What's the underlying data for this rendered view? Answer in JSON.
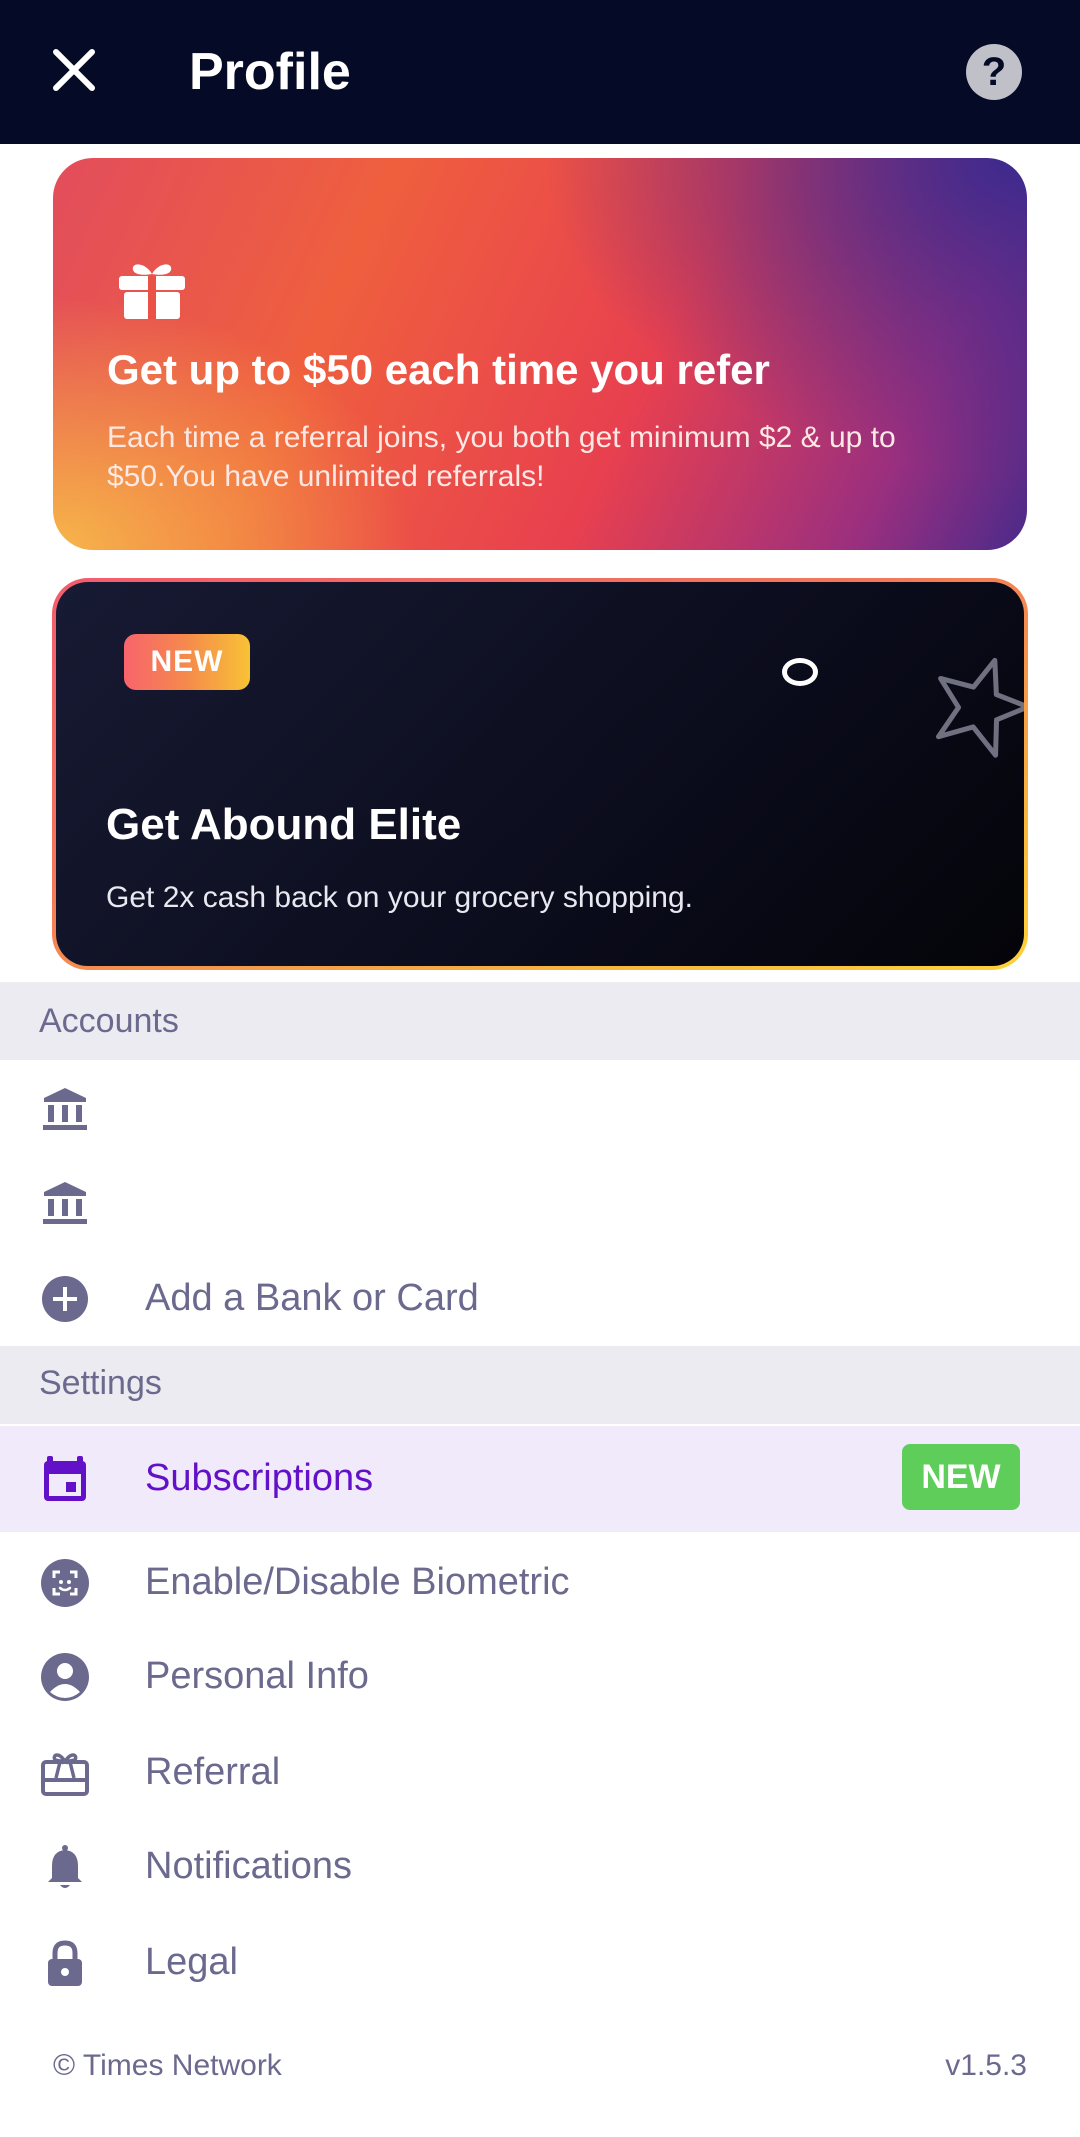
{
  "header": {
    "title": "Profile",
    "help_label": "?"
  },
  "referral_card": {
    "title": "Get up to $50 each time you refer",
    "description": "Each time a referral joins, you both get minimum $2 & up to $50.You have unlimited referrals!"
  },
  "elite_card": {
    "badge": "NEW",
    "title": "Get Abound Elite",
    "description": "Get 2x cash back on your grocery shopping."
  },
  "accounts": {
    "header": "Accounts",
    "add_label": "Add a Bank or Card"
  },
  "settings": {
    "header": "Settings",
    "items": [
      {
        "label": "Subscriptions",
        "badge": "NEW"
      },
      {
        "label": "Enable/Disable Biometric"
      },
      {
        "label": "Personal Info"
      },
      {
        "label": "Referral"
      },
      {
        "label": "Notifications"
      },
      {
        "label": "Legal"
      }
    ]
  },
  "footer": {
    "copyright": "© Times Network",
    "version": "v1.5.3"
  },
  "colors": {
    "header_bg": "#050a26",
    "accent_purple": "#6311c8",
    "active_row_bg": "#f0eafb",
    "section_bg": "#ebebf1",
    "muted_text": "#6b6a8e",
    "new_badge_green": "#5fcd5a"
  }
}
